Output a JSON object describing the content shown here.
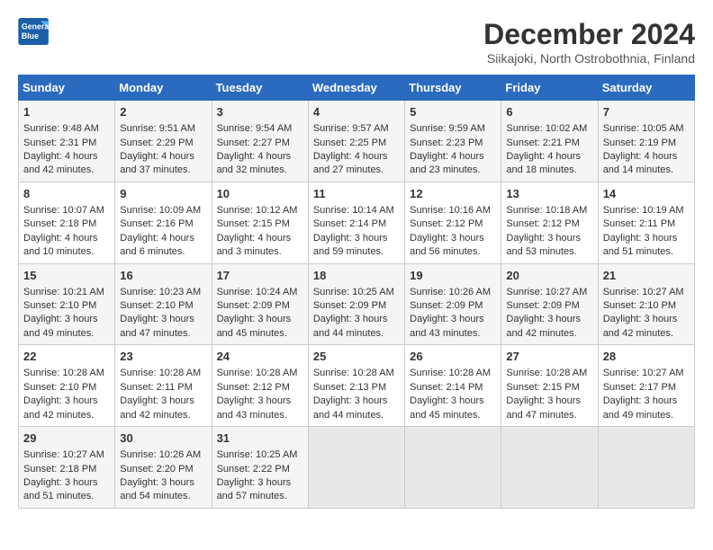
{
  "header": {
    "logo_line1": "General",
    "logo_line2": "Blue",
    "month_title": "December 2024",
    "location": "Siikajoki, North Ostrobothnia, Finland"
  },
  "weekdays": [
    "Sunday",
    "Monday",
    "Tuesday",
    "Wednesday",
    "Thursday",
    "Friday",
    "Saturday"
  ],
  "weeks": [
    [
      {
        "day": "1",
        "lines": [
          "Sunrise: 9:48 AM",
          "Sunset: 2:31 PM",
          "Daylight: 4 hours",
          "and 42 minutes."
        ]
      },
      {
        "day": "2",
        "lines": [
          "Sunrise: 9:51 AM",
          "Sunset: 2:29 PM",
          "Daylight: 4 hours",
          "and 37 minutes."
        ]
      },
      {
        "day": "3",
        "lines": [
          "Sunrise: 9:54 AM",
          "Sunset: 2:27 PM",
          "Daylight: 4 hours",
          "and 32 minutes."
        ]
      },
      {
        "day": "4",
        "lines": [
          "Sunrise: 9:57 AM",
          "Sunset: 2:25 PM",
          "Daylight: 4 hours",
          "and 27 minutes."
        ]
      },
      {
        "day": "5",
        "lines": [
          "Sunrise: 9:59 AM",
          "Sunset: 2:23 PM",
          "Daylight: 4 hours",
          "and 23 minutes."
        ]
      },
      {
        "day": "6",
        "lines": [
          "Sunrise: 10:02 AM",
          "Sunset: 2:21 PM",
          "Daylight: 4 hours",
          "and 18 minutes."
        ]
      },
      {
        "day": "7",
        "lines": [
          "Sunrise: 10:05 AM",
          "Sunset: 2:19 PM",
          "Daylight: 4 hours",
          "and 14 minutes."
        ]
      }
    ],
    [
      {
        "day": "8",
        "lines": [
          "Sunrise: 10:07 AM",
          "Sunset: 2:18 PM",
          "Daylight: 4 hours",
          "and 10 minutes."
        ]
      },
      {
        "day": "9",
        "lines": [
          "Sunrise: 10:09 AM",
          "Sunset: 2:16 PM",
          "Daylight: 4 hours",
          "and 6 minutes."
        ]
      },
      {
        "day": "10",
        "lines": [
          "Sunrise: 10:12 AM",
          "Sunset: 2:15 PM",
          "Daylight: 4 hours",
          "and 3 minutes."
        ]
      },
      {
        "day": "11",
        "lines": [
          "Sunrise: 10:14 AM",
          "Sunset: 2:14 PM",
          "Daylight: 3 hours",
          "and 59 minutes."
        ]
      },
      {
        "day": "12",
        "lines": [
          "Sunrise: 10:16 AM",
          "Sunset: 2:12 PM",
          "Daylight: 3 hours",
          "and 56 minutes."
        ]
      },
      {
        "day": "13",
        "lines": [
          "Sunrise: 10:18 AM",
          "Sunset: 2:12 PM",
          "Daylight: 3 hours",
          "and 53 minutes."
        ]
      },
      {
        "day": "14",
        "lines": [
          "Sunrise: 10:19 AM",
          "Sunset: 2:11 PM",
          "Daylight: 3 hours",
          "and 51 minutes."
        ]
      }
    ],
    [
      {
        "day": "15",
        "lines": [
          "Sunrise: 10:21 AM",
          "Sunset: 2:10 PM",
          "Daylight: 3 hours",
          "and 49 minutes."
        ]
      },
      {
        "day": "16",
        "lines": [
          "Sunrise: 10:23 AM",
          "Sunset: 2:10 PM",
          "Daylight: 3 hours",
          "and 47 minutes."
        ]
      },
      {
        "day": "17",
        "lines": [
          "Sunrise: 10:24 AM",
          "Sunset: 2:09 PM",
          "Daylight: 3 hours",
          "and 45 minutes."
        ]
      },
      {
        "day": "18",
        "lines": [
          "Sunrise: 10:25 AM",
          "Sunset: 2:09 PM",
          "Daylight: 3 hours",
          "and 44 minutes."
        ]
      },
      {
        "day": "19",
        "lines": [
          "Sunrise: 10:26 AM",
          "Sunset: 2:09 PM",
          "Daylight: 3 hours",
          "and 43 minutes."
        ]
      },
      {
        "day": "20",
        "lines": [
          "Sunrise: 10:27 AM",
          "Sunset: 2:09 PM",
          "Daylight: 3 hours",
          "and 42 minutes."
        ]
      },
      {
        "day": "21",
        "lines": [
          "Sunrise: 10:27 AM",
          "Sunset: 2:10 PM",
          "Daylight: 3 hours",
          "and 42 minutes."
        ]
      }
    ],
    [
      {
        "day": "22",
        "lines": [
          "Sunrise: 10:28 AM",
          "Sunset: 2:10 PM",
          "Daylight: 3 hours",
          "and 42 minutes."
        ]
      },
      {
        "day": "23",
        "lines": [
          "Sunrise: 10:28 AM",
          "Sunset: 2:11 PM",
          "Daylight: 3 hours",
          "and 42 minutes."
        ]
      },
      {
        "day": "24",
        "lines": [
          "Sunrise: 10:28 AM",
          "Sunset: 2:12 PM",
          "Daylight: 3 hours",
          "and 43 minutes."
        ]
      },
      {
        "day": "25",
        "lines": [
          "Sunrise: 10:28 AM",
          "Sunset: 2:13 PM",
          "Daylight: 3 hours",
          "and 44 minutes."
        ]
      },
      {
        "day": "26",
        "lines": [
          "Sunrise: 10:28 AM",
          "Sunset: 2:14 PM",
          "Daylight: 3 hours",
          "and 45 minutes."
        ]
      },
      {
        "day": "27",
        "lines": [
          "Sunrise: 10:28 AM",
          "Sunset: 2:15 PM",
          "Daylight: 3 hours",
          "and 47 minutes."
        ]
      },
      {
        "day": "28",
        "lines": [
          "Sunrise: 10:27 AM",
          "Sunset: 2:17 PM",
          "Daylight: 3 hours",
          "and 49 minutes."
        ]
      }
    ],
    [
      {
        "day": "29",
        "lines": [
          "Sunrise: 10:27 AM",
          "Sunset: 2:18 PM",
          "Daylight: 3 hours",
          "and 51 minutes."
        ]
      },
      {
        "day": "30",
        "lines": [
          "Sunrise: 10:26 AM",
          "Sunset: 2:20 PM",
          "Daylight: 3 hours",
          "and 54 minutes."
        ]
      },
      {
        "day": "31",
        "lines": [
          "Sunrise: 10:25 AM",
          "Sunset: 2:22 PM",
          "Daylight: 3 hours",
          "and 57 minutes."
        ]
      },
      null,
      null,
      null,
      null
    ]
  ]
}
